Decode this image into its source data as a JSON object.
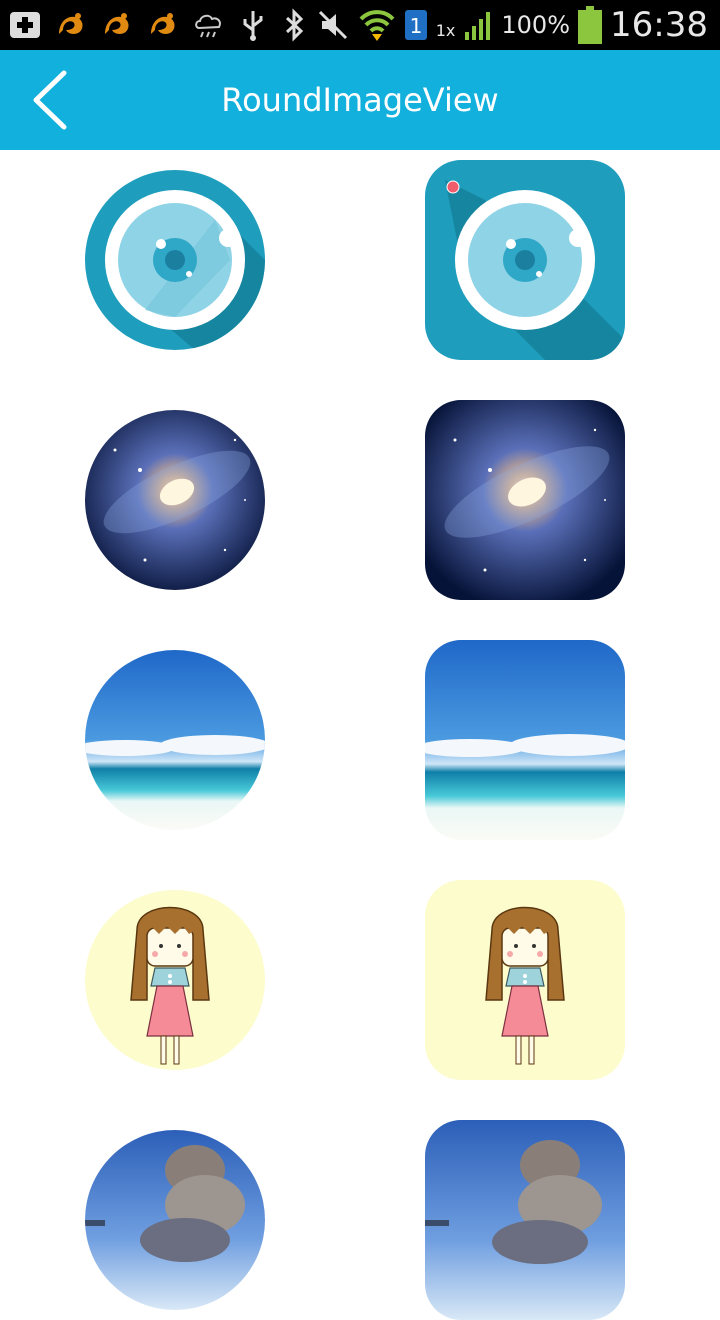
{
  "status_bar": {
    "time": "16:38",
    "battery_percent": "100%",
    "network_rate": "1x",
    "sim_slot": "1",
    "icons": [
      "add-icon",
      "uc-browser-icon",
      "uc-browser-icon",
      "uc-browser-icon",
      "weather-rain-icon",
      "usb-icon",
      "bluetooth-icon",
      "mute-icon",
      "wifi-icon",
      "sim-icon",
      "signal-icon",
      "battery-icon"
    ]
  },
  "app_bar": {
    "title": "RoundImageView",
    "back_icon": "chevron-left-icon",
    "color": "#12b0dd"
  },
  "grid": {
    "columns": 2,
    "rows": [
      {
        "name": "camera",
        "left": "round",
        "right": "rounded-square"
      },
      {
        "name": "galaxy",
        "left": "round",
        "right": "rounded-square"
      },
      {
        "name": "beach",
        "left": "round",
        "right": "rounded-square"
      },
      {
        "name": "cartoon-girl",
        "left": "round",
        "right": "rounded-square"
      },
      {
        "name": "clouds",
        "left": "round",
        "right": "rounded-square"
      }
    ]
  }
}
